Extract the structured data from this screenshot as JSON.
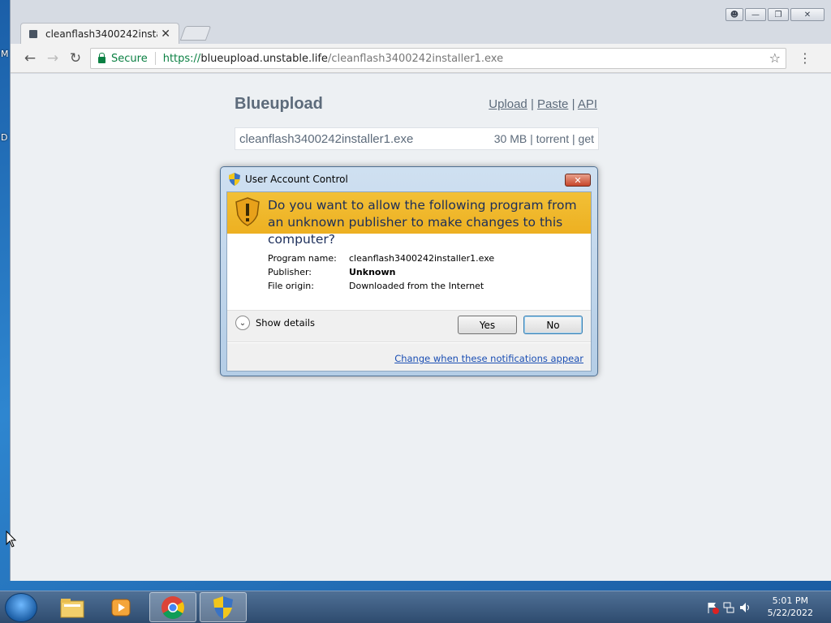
{
  "desktop": {
    "left_letters": [
      "M",
      "D"
    ]
  },
  "browser": {
    "tab_title": "cleanflash3400242installe",
    "omnibox": {
      "secure_label": "Secure",
      "url_scheme": "https://",
      "url_host": "blueupload.unstable.life",
      "url_path": "/cleanflash3400242installer1.exe"
    }
  },
  "page": {
    "site_title": "Blueupload",
    "links": [
      "Upload",
      "Paste",
      "API"
    ],
    "file": {
      "name": "cleanflash3400242installer1.exe",
      "size": "30 MB",
      "torrent": "torrent",
      "get": "get"
    }
  },
  "uac": {
    "title": "User Account Control",
    "question": "Do you want to allow the following program from an unknown publisher to make changes to this computer?",
    "details": [
      {
        "label": "Program name:",
        "value": "cleanflash3400242installer1.exe"
      },
      {
        "label": "Publisher:",
        "value": "Unknown"
      },
      {
        "label": "File origin:",
        "value": "Downloaded from the Internet"
      }
    ],
    "show_details": "Show details",
    "yes": "Yes",
    "no": "No",
    "change_link": "Change when these notifications appear"
  },
  "taskbar": {
    "time": "5:01 PM",
    "date": "5/22/2022"
  },
  "colors": {
    "uac_header": "#edb021",
    "secure_green": "#0b8043",
    "page_text": "#5d6b7b"
  }
}
